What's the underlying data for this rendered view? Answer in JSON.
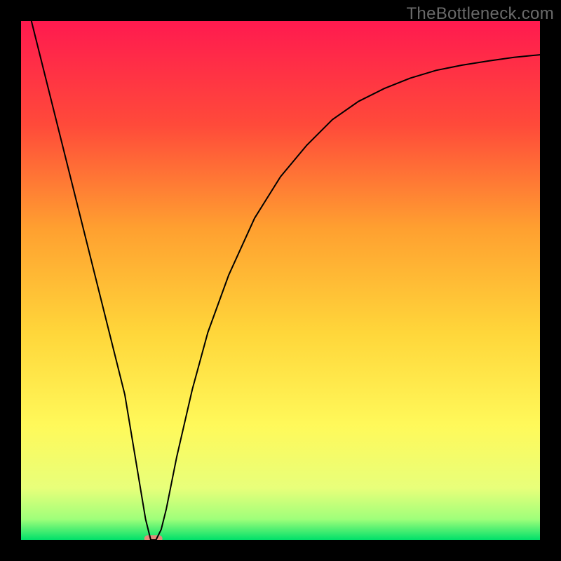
{
  "watermark": "TheBottleneck.com",
  "chart_data": {
    "type": "line",
    "title": "",
    "xlabel": "",
    "ylabel": "",
    "xlim": [
      0,
      100
    ],
    "ylim": [
      0,
      100
    ],
    "axes_visible": false,
    "legend": false,
    "background_gradient": {
      "type": "vertical-linear",
      "stops": [
        {
          "pos": 0.0,
          "color": "#ff1a4f"
        },
        {
          "pos": 0.2,
          "color": "#ff4a3a"
        },
        {
          "pos": 0.4,
          "color": "#ffa030"
        },
        {
          "pos": 0.6,
          "color": "#ffd63a"
        },
        {
          "pos": 0.78,
          "color": "#fff95a"
        },
        {
          "pos": 0.9,
          "color": "#e8ff7a"
        },
        {
          "pos": 0.96,
          "color": "#9fff7a"
        },
        {
          "pos": 1.0,
          "color": "#00e06a"
        }
      ]
    },
    "series": [
      {
        "name": "bottleneck-curve",
        "color": "#000000",
        "width": 2,
        "x": [
          2,
          5,
          10,
          15,
          20,
          24,
          25,
          26,
          27,
          28,
          30,
          33,
          36,
          40,
          45,
          50,
          55,
          60,
          65,
          70,
          75,
          80,
          85,
          90,
          95,
          100
        ],
        "y": [
          100,
          88,
          68,
          48,
          28,
          4,
          0,
          0,
          2,
          6,
          16,
          29,
          40,
          51,
          62,
          70,
          76,
          81,
          84.5,
          87,
          89,
          90.5,
          91.5,
          92.3,
          93,
          93.5
        ]
      }
    ],
    "marker": {
      "name": "minimum-marker",
      "shape": "rounded-rect",
      "color": "#e48a7a",
      "x_center": 25.5,
      "y_center": 0,
      "width_pct": 3.5,
      "height_pct": 1.3
    }
  }
}
